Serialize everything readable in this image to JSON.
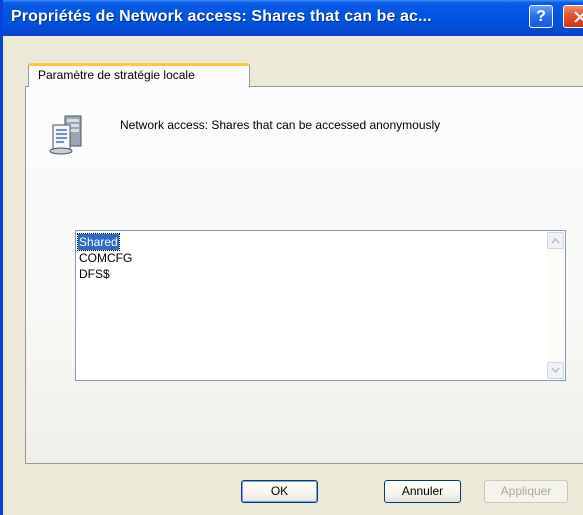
{
  "window": {
    "title": "Propriétés de Network access: Shares that can be ac...",
    "help_label": "?"
  },
  "tab": {
    "label": "Paramètre de stratégie locale"
  },
  "policy": {
    "icon": "policy-server-icon",
    "title": "Network access: Shares that can be accessed anonymously"
  },
  "listbox": {
    "items": [
      "Shared",
      "COMCFG",
      "DFS$"
    ],
    "selected_index": 0
  },
  "buttons": {
    "ok": "OK",
    "cancel": "Annuler",
    "apply": "Appliquer"
  },
  "colors": {
    "titlebar": "#0254e2",
    "selection": "#316ac5",
    "tab_highlight": "#ffc83c"
  }
}
